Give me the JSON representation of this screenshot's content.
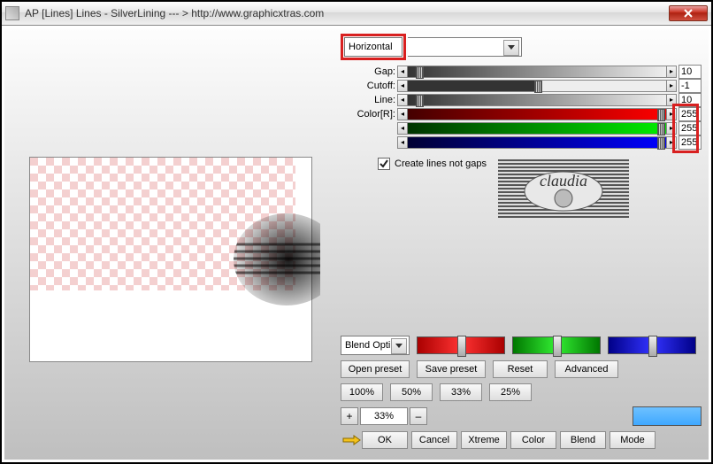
{
  "window": {
    "title": "AP [Lines]  Lines - SilverLining   --- > http://www.graphicxtras.com",
    "close_x": "×"
  },
  "direction": {
    "value": "Horizontal"
  },
  "sliders": {
    "gap": {
      "label": "Gap:",
      "value": "10"
    },
    "cutoff": {
      "label": "Cutoff:",
      "value": "-1"
    },
    "line": {
      "label": "Line:",
      "value": "10"
    },
    "r": {
      "label": "Color[R]:",
      "value": "255"
    },
    "g": {
      "label": "",
      "value": "255"
    },
    "b": {
      "label": "",
      "value": "255"
    }
  },
  "checkbox": {
    "label": "Create lines not gaps",
    "checked": true
  },
  "blend_dd": "Blend Opti",
  "buttons": {
    "open_preset": "Open preset",
    "save_preset": "Save preset",
    "reset": "Reset",
    "advanced": "Advanced",
    "p100": "100%",
    "p50": "50%",
    "p33": "33%",
    "p25": "25%",
    "ok": "OK",
    "cancel": "Cancel",
    "xtreme": "Xtreme",
    "color": "Color",
    "blend": "Blend",
    "mode": "Mode"
  },
  "zoom": {
    "plus": "+",
    "value": "33%",
    "minus": "–"
  },
  "logo_text": "claudia"
}
